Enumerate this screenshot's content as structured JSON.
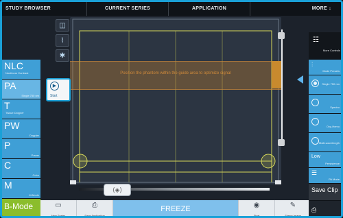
{
  "topbar": {
    "items": [
      "STUDY BROWSER",
      "CURRENT SERIES",
      "APPLICATION",
      "MORE"
    ],
    "more_chevron": "↓"
  },
  "left_modes": [
    {
      "big": "NLC",
      "small": "",
      "sub": "Nonlinear Contrast"
    },
    {
      "big": "PA",
      "small": "Single 750 nm",
      "sub": ""
    },
    {
      "big": "T",
      "small": "",
      "sub": "Tissue Doppler"
    },
    {
      "big": "PW",
      "small": "Doppler",
      "sub": ""
    },
    {
      "big": "P",
      "small": "Power",
      "sub": ""
    },
    {
      "big": "C",
      "small": "Color",
      "sub": ""
    },
    {
      "big": "M",
      "small": "M-Mode",
      "sub": ""
    },
    {
      "big": "B-Mode",
      "small": "",
      "sub": ""
    }
  ],
  "start_tile": {
    "label": "Start",
    "icon": "play-icon"
  },
  "image": {
    "banner_text": "Position the phantom within the guide area to optimize signal"
  },
  "bottom_bar": {
    "new_series": "New Series",
    "save_application": "Save Application",
    "freeze": "FREEZE",
    "start": "Start",
    "stamp_image": "Stamp Image"
  },
  "right_panel": {
    "menu_label": "More Controls",
    "mode_presets": "Mode Presets",
    "single_750": "Single 750 nm",
    "spectro": "Spectro",
    "oxy_hemo": "Oxy-Hemo",
    "multi_wave": "Multi-wavelength",
    "low": "Low",
    "persistence": "Persistence",
    "pa_mode": "PA Mode",
    "save_clip": "Save Clip"
  },
  "colors": {
    "accent": "#1aa1d8",
    "mode_blue": "#3f9fd6",
    "bmode_green": "#8bbd2c",
    "guide_yellow": "#d7d95a",
    "banner_orange": "#c9832e"
  },
  "icons": {
    "cube": "cube-icon",
    "pulse": "pulse-icon",
    "target": "target-icon",
    "menu": "grid-menu-icon",
    "settings": "sliders-icon",
    "arrow_left": "chevron-left-icon",
    "new_series": "new-document-icon",
    "save_application": "save-printer-icon",
    "start_play": "play-circle-icon",
    "stamp": "stamp-icon",
    "save_clip": "save-clip-icon"
  }
}
